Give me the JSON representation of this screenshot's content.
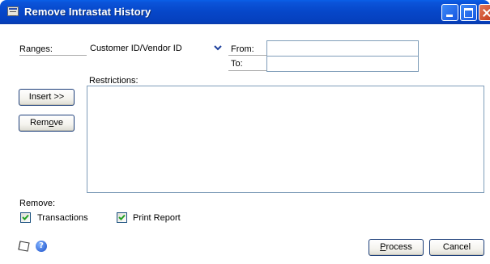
{
  "window": {
    "title": "Remove Intrastat History"
  },
  "ranges": {
    "label": "Ranges:",
    "selected": "Customer ID/Vendor ID",
    "from_label": "From:",
    "to_label": "To:",
    "from_value": "",
    "to_value": ""
  },
  "restrictions": {
    "label": "Restrictions:",
    "items": []
  },
  "buttons": {
    "insert": "Insert >>",
    "remove_prefix": "Rem",
    "remove_mnemonic": "o",
    "remove_suffix": "ve",
    "process_mnemonic": "P",
    "process_suffix": "rocess",
    "cancel": "Cancel"
  },
  "remove_section": {
    "label": "Remove:",
    "transactions": {
      "label": "Transactions",
      "checked": true
    },
    "print_report": {
      "label": "Print Report",
      "checked": true
    }
  },
  "icons": {
    "note": "note-icon",
    "help": "help-icon",
    "combo_arrow": "chevron-down-icon"
  },
  "colors": {
    "titlebar": "#0646c8",
    "input_border": "#7f9db9",
    "button_border": "#1d3f7a"
  }
}
